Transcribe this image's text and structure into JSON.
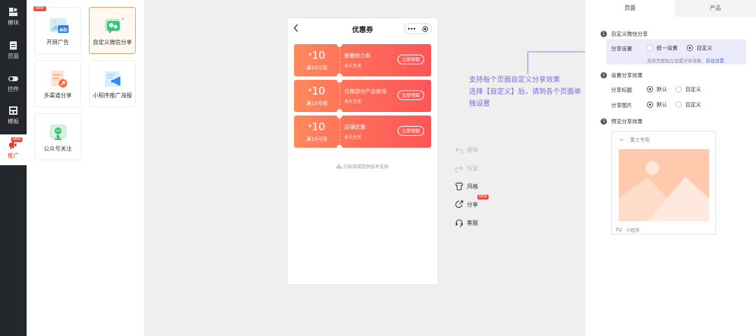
{
  "rail": {
    "items": [
      {
        "label": "模块",
        "icon": "block-icon"
      },
      {
        "label": "页面",
        "icon": "page-icon"
      },
      {
        "label": "控件",
        "icon": "toggle-icon"
      },
      {
        "label": "模板",
        "icon": "template-icon"
      },
      {
        "label": "推广",
        "icon": "megaphone-icon",
        "badge": "NEW",
        "active": true
      }
    ]
  },
  "components": {
    "cards": [
      {
        "label": "开屏广告",
        "badge": "NEW"
      },
      {
        "label": "自定义微信分享",
        "selected": true
      },
      {
        "label": "多渠道分享"
      },
      {
        "label": "小程序推广海报"
      },
      {
        "label": "公众号关注"
      }
    ]
  },
  "phone": {
    "title": "优惠券",
    "coupons": [
      {
        "currency": "¥",
        "amount": "10",
        "condition": "满10可用",
        "name": "新春给力券",
        "validity": "永久生效",
        "button": "立即领取"
      },
      {
        "currency": "¥",
        "amount": "10",
        "condition": "满10可用",
        "name": "仅限部分产品使用",
        "validity": "永久生效",
        "button": "立即领取"
      },
      {
        "currency": "¥",
        "amount": "10",
        "condition": "满10可用",
        "name": "店铺优惠",
        "validity": "永久生效",
        "button": "立即领取"
      }
    ],
    "footer": "凡科商城提供技术支持"
  },
  "annotation": {
    "lines": [
      "支持每个页面自定义分享效果",
      "选择【自定义】后，请到各个页面单",
      "独设置"
    ]
  },
  "tools": [
    {
      "label": "撤销",
      "icon": "undo-icon",
      "disabled": true
    },
    {
      "label": "恢复",
      "icon": "redo-icon",
      "disabled": true
    },
    {
      "label": "风格",
      "icon": "shirt-icon"
    },
    {
      "label": "分享",
      "icon": "share-icon",
      "badge": "NEW"
    },
    {
      "label": "客服",
      "icon": "headset-icon"
    }
  ],
  "settings": {
    "tabs": [
      "页面",
      "产品"
    ],
    "section1": {
      "num": "1",
      "title": "自定义微信分享",
      "row_label": "分享设置",
      "options": [
        "统一设置",
        "自定义"
      ],
      "selected": "自定义",
      "hint": "支持页面独立设置分享效果，",
      "hint_link": "前往设置"
    },
    "section2": {
      "num": "2",
      "title": "设置分享效果",
      "title_row": {
        "label": "分享标题",
        "options": [
          "默认",
          "自定义"
        ],
        "selected": "默认"
      },
      "image_row": {
        "label": "分享图片",
        "options": [
          "默认",
          "自定义"
        ],
        "selected": "默认"
      }
    },
    "section3": {
      "num": "3",
      "title": "预览分享效果",
      "preview_back": "←",
      "preview_name": "策士专用",
      "preview_foot": "小程序"
    }
  },
  "colors": {
    "accent": "#f04a3a",
    "coupon_start": "#ff8a5b",
    "coupon_end": "#fd5558",
    "annotation": "#7a6be6",
    "link": "#4a6ee0"
  }
}
